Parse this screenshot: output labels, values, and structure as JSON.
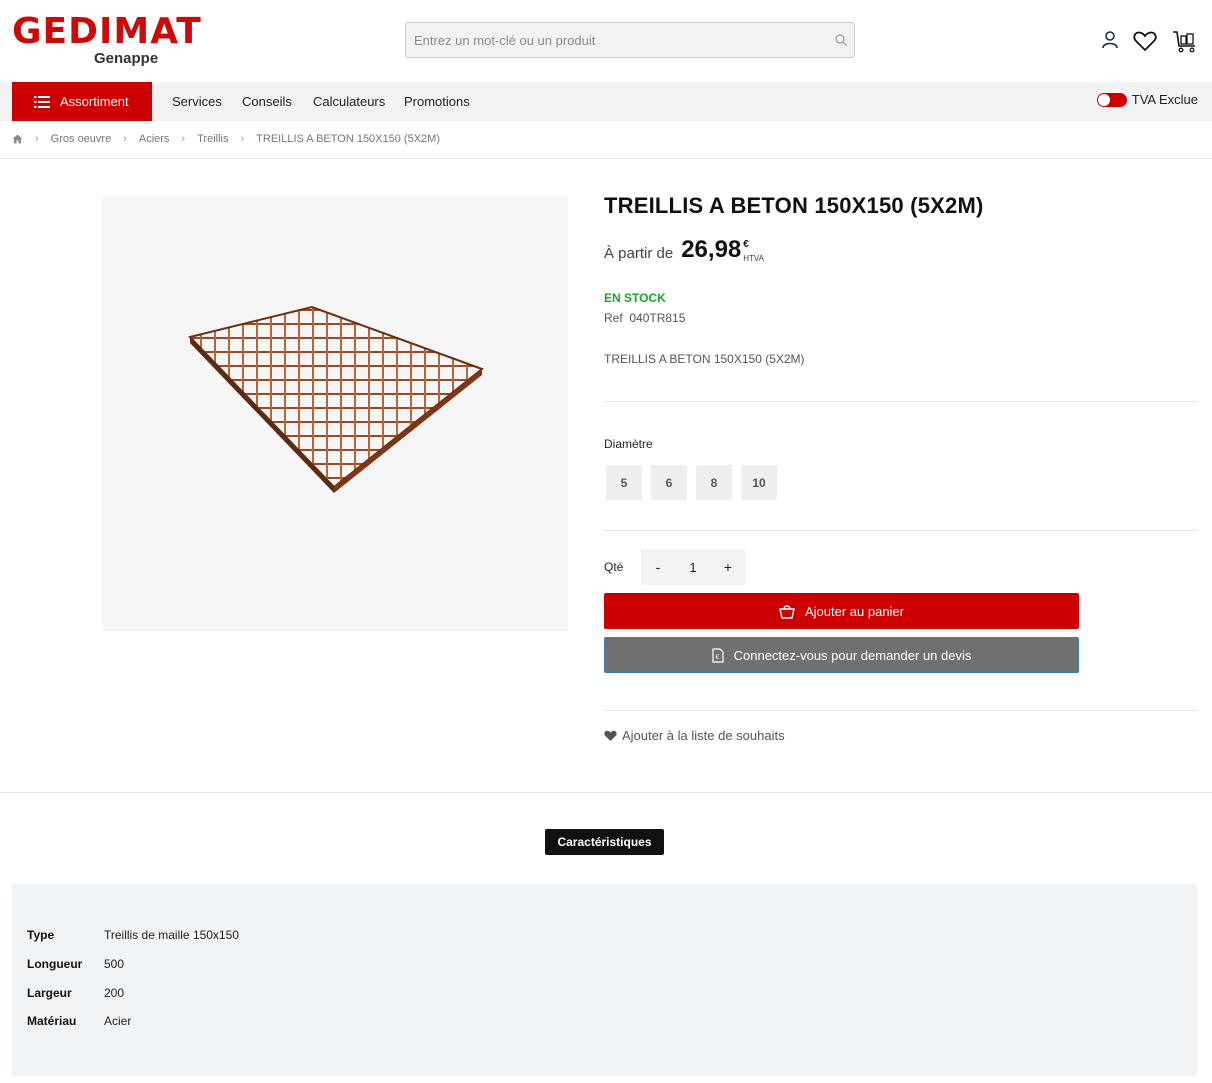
{
  "header": {
    "logo_main": "GEDIMAT",
    "logo_sub": "Genappe",
    "search_placeholder": "Entrez un mot-clé ou un produit"
  },
  "nav": {
    "assortiment": "Assortiment",
    "links": [
      "Services",
      "Conseils",
      "Calculateurs",
      "Promotions"
    ],
    "tva_label": "TVA Exclue"
  },
  "breadcrumb": [
    "Gros oeuvre",
    "Aciers",
    "Treillis",
    "TREILLIS A BETON 150X150 (5X2M)"
  ],
  "product": {
    "title": "TREILLIS A BETON 150X150 (5X2M)",
    "price_prefix": "À partir de",
    "price": "26,98",
    "currency": "€",
    "tax_label": "HTVA",
    "stock": "EN STOCK",
    "ref_label": "Ref",
    "ref_value": "040TR815",
    "short_description": "TREILLIS A BETON 150X150 (5X2M)",
    "diameter_label": "Diamètre",
    "diameters": [
      "5",
      "6",
      "8",
      "10"
    ],
    "qty_label": "Qté",
    "qty_minus": "-",
    "qty_value": "1",
    "qty_plus": "+",
    "add_to_cart": "Ajouter au panier",
    "quote": "Connectez-vous pour demander un devis",
    "wishlist": "Ajouter à la liste de souhaits"
  },
  "characteristics": {
    "tab_label": "Caractéristiques",
    "rows": [
      {
        "key": "Type",
        "value": "Treillis de maille 150x150"
      },
      {
        "key": "Longueur",
        "value": "500"
      },
      {
        "key": "Largeur",
        "value": "200"
      },
      {
        "key": "Matériau",
        "value": "Acier"
      }
    ]
  },
  "colors": {
    "brand_red": "#cc0000",
    "stock_green": "#1aa32c",
    "quote_gray": "#707070"
  }
}
